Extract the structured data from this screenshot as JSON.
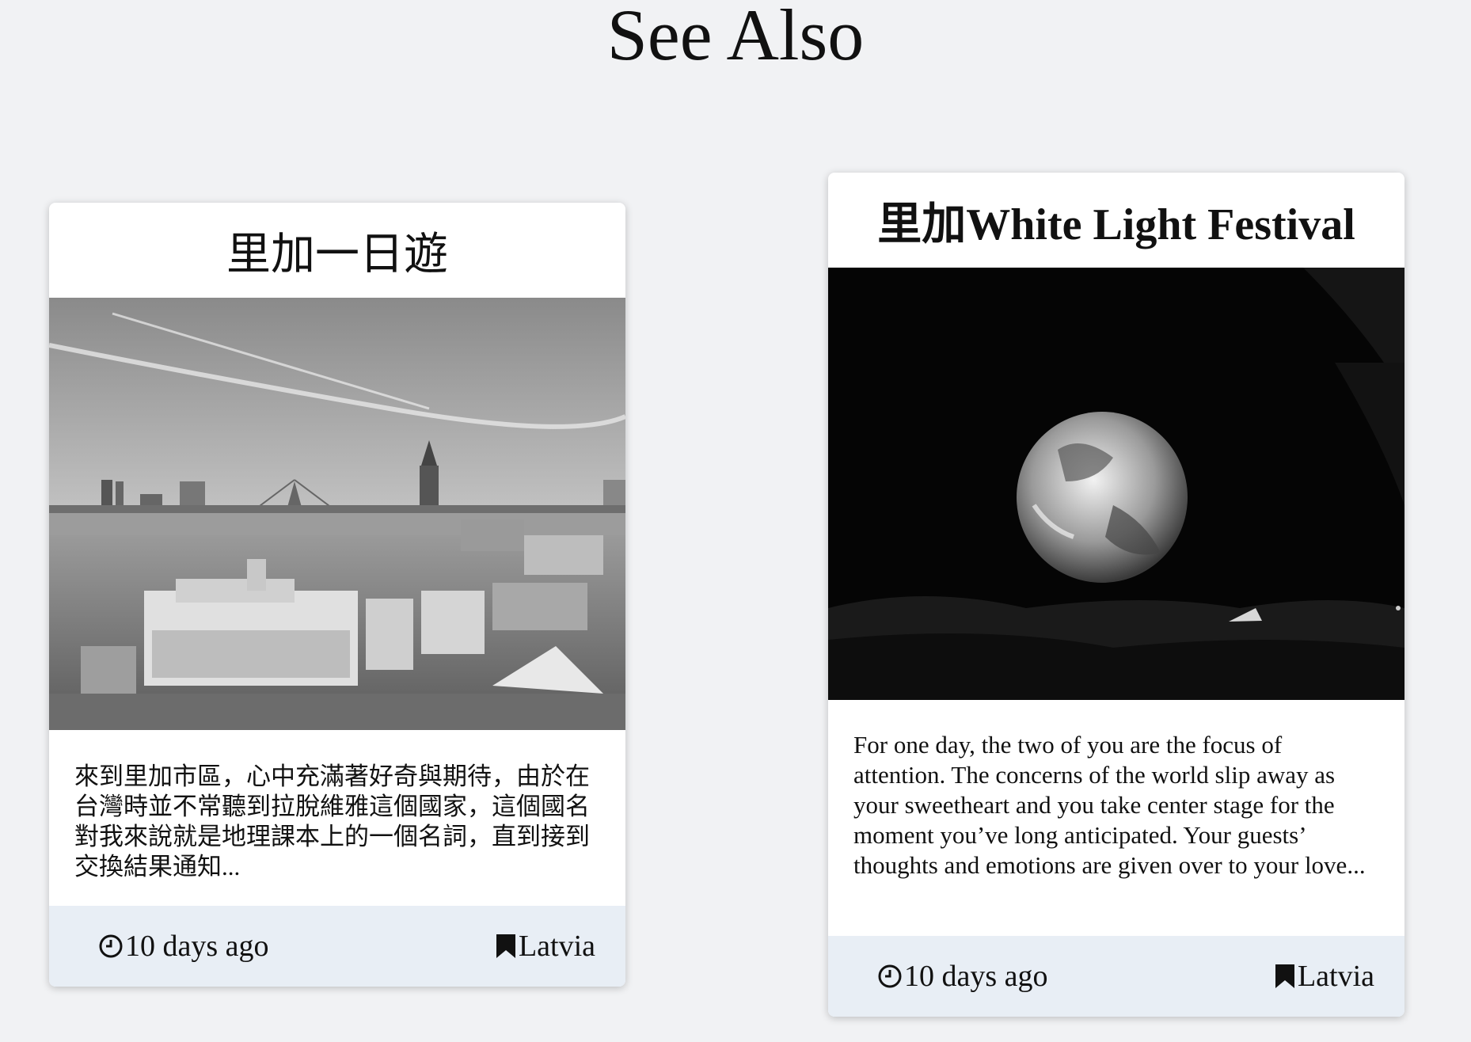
{
  "page": {
    "title": "See Also"
  },
  "cards": [
    {
      "title": "里加一日遊",
      "image_alt": "Riga old town skyline with river and bridge",
      "excerpt": "來到里加市區，心中充滿著好奇與期待，由於在台灣時並不常聽到拉脫維雅這個國家，這個國名對我來說就是地理課本上的一個名詞，直到接到交換結果通知...",
      "time": "10 days ago",
      "tag": "Latvia"
    },
    {
      "title": "里加White Light Festival",
      "image_alt": "Illuminated globe installation at night",
      "excerpt": "For one day, the two of you are the focus of attention. The concerns of the world slip away as your sweetheart and you take center stage for the moment you’ve long anticipated. Your guests’ thoughts and emotions are given over to your love...",
      "time": "10 days ago",
      "tag": "Latvia"
    }
  ]
}
